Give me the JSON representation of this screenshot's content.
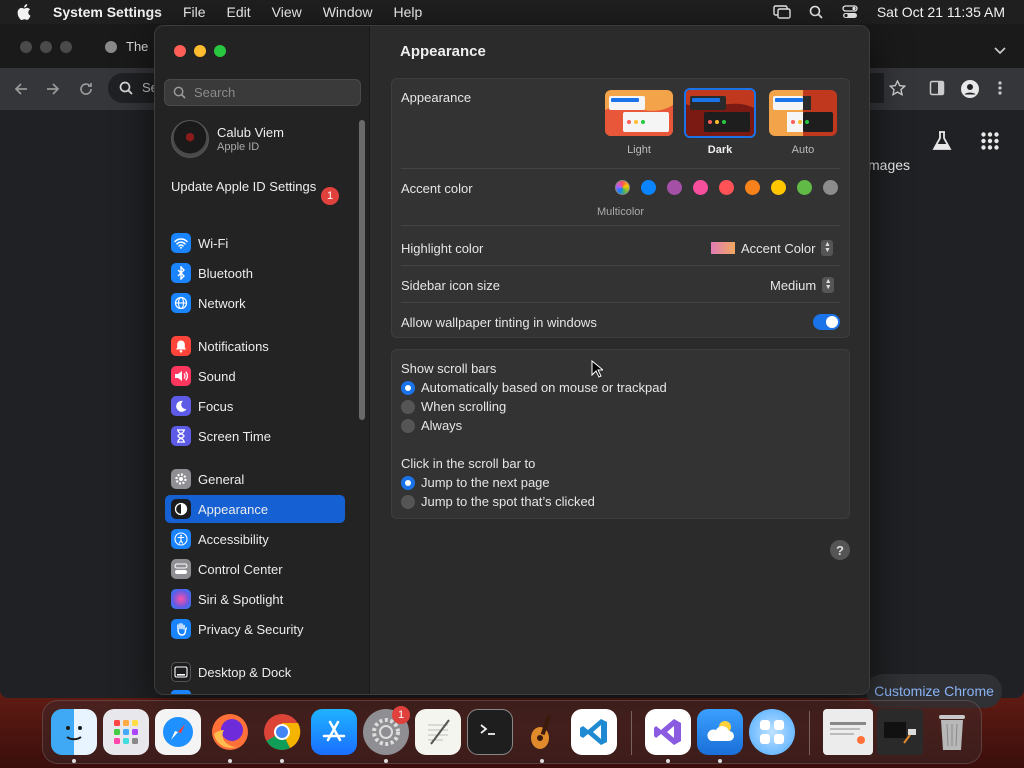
{
  "menubar": {
    "app": "System Settings",
    "items": [
      "File",
      "Edit",
      "View",
      "Window",
      "Help"
    ],
    "clock": "Sat Oct 21  11:35 AM"
  },
  "chrome": {
    "tab_title": "The",
    "omnibox_partial": "Se",
    "images_link": "mages",
    "customize": "Customize Chrome"
  },
  "sidebar": {
    "search_placeholder": "Search",
    "profile": {
      "name": "Calub Viem",
      "subtitle": "Apple ID"
    },
    "update": {
      "label": "Update Apple ID Settings",
      "badge": "1"
    },
    "items": [
      {
        "label": "Wi-Fi",
        "icon": "wifi-icon",
        "color": "#1a84ff"
      },
      {
        "label": "Bluetooth",
        "icon": "bluetooth-icon",
        "color": "#1a84ff"
      },
      {
        "label": "Network",
        "icon": "globe-icon",
        "color": "#1a84ff"
      },
      {
        "label": "Notifications",
        "icon": "bell-icon",
        "color": "#ff453a"
      },
      {
        "label": "Sound",
        "icon": "speaker-icon",
        "color": "#ff375f"
      },
      {
        "label": "Focus",
        "icon": "moon-icon",
        "color": "#5e5ce6"
      },
      {
        "label": "Screen Time",
        "icon": "hourglass-icon",
        "color": "#5e5ce6"
      },
      {
        "label": "General",
        "icon": "gear-icon",
        "color": "#8e8e93"
      },
      {
        "label": "Appearance",
        "icon": "appearance-icon",
        "color": "#1c1c1e"
      },
      {
        "label": "Accessibility",
        "icon": "accessibility-icon",
        "color": "#1a84ff"
      },
      {
        "label": "Control Center",
        "icon": "control-center-icon",
        "color": "#8e8e93"
      },
      {
        "label": "Siri & Spotlight",
        "icon": "siri-icon",
        "color": "#bf5af2"
      },
      {
        "label": "Privacy & Security",
        "icon": "hand-icon",
        "color": "#1a84ff"
      },
      {
        "label": "Desktop & Dock",
        "icon": "dock-icon",
        "color": "#1c1c1e"
      }
    ],
    "selected": "Appearance"
  },
  "main": {
    "title": "Appearance",
    "appearance": {
      "label": "Appearance",
      "options": [
        "Light",
        "Dark",
        "Auto"
      ],
      "selected": "Dark"
    },
    "accent": {
      "label": "Accent color",
      "caption": "Multicolor",
      "colors": [
        "#bf5af2",
        "#0a84ff",
        "#a550a7",
        "#f74f9e",
        "#ff5257",
        "#f7821b",
        "#ffc600",
        "#62ba46",
        "#8c8c8c"
      ]
    },
    "highlight": {
      "label": "Highlight color",
      "value": "Accent Color"
    },
    "sidebar_icon": {
      "label": "Sidebar icon size",
      "value": "Medium"
    },
    "tinting": {
      "label": "Allow wallpaper tinting in windows",
      "on": true
    },
    "scroll": {
      "label": "Show scroll bars",
      "options": [
        "Automatically based on mouse or trackpad",
        "When scrolling",
        "Always"
      ],
      "selected": 0
    },
    "click": {
      "label": "Click in the scroll bar to",
      "options": [
        "Jump to the next page",
        "Jump to the spot that’s clicked"
      ],
      "selected": 0
    },
    "help": "?"
  },
  "dock": {
    "apps": [
      "Finder",
      "Launchpad",
      "Safari",
      "Firefox",
      "Google Chrome",
      "App Store",
      "System Settings",
      "TextEdit",
      "Terminal",
      "GarageBand",
      "Visual Studio Code",
      "Visual Studio",
      "Weather",
      "Multi",
      "Window Preview",
      "Trash"
    ],
    "settings_badge": "1"
  }
}
